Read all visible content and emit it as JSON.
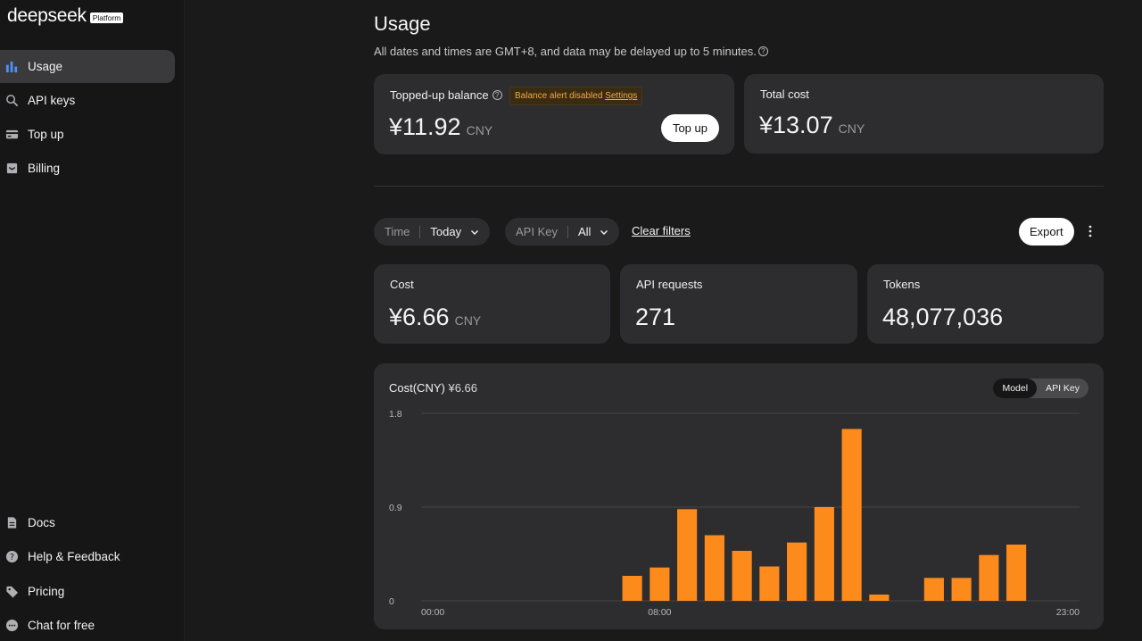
{
  "brand": {
    "name": "deepseek",
    "badge": "Platform"
  },
  "sidebar": {
    "items": [
      {
        "label": "Usage",
        "icon": "bar-chart-icon",
        "active": true
      },
      {
        "label": "API keys",
        "icon": "search-icon"
      },
      {
        "label": "Top up",
        "icon": "wallet-icon"
      },
      {
        "label": "Billing",
        "icon": "invoice-icon"
      }
    ],
    "bottom": [
      {
        "label": "Docs",
        "icon": "document-icon"
      },
      {
        "label": "Help & Feedback",
        "icon": "help-icon"
      },
      {
        "label": "Pricing",
        "icon": "tag-icon"
      },
      {
        "label": "Chat for free",
        "icon": "chat-icon"
      }
    ]
  },
  "page": {
    "title": "Usage",
    "subtitle": "All dates and times are GMT+8, and data may be delayed up to 5 minutes."
  },
  "balance": {
    "label": "Topped-up balance",
    "alert_text": "Balance alert disabled",
    "alert_link": "Settings",
    "value": "¥11.92",
    "unit": "CNY",
    "button": "Top up"
  },
  "total_cost": {
    "label": "Total cost",
    "value": "¥13.07",
    "unit": "CNY"
  },
  "filters": {
    "time_key": "Time",
    "time_value": "Today",
    "apikey_key": "API Key",
    "apikey_value": "All",
    "clear": "Clear filters",
    "export": "Export"
  },
  "stats": {
    "cost": {
      "label": "Cost",
      "value": "¥6.66",
      "unit": "CNY"
    },
    "requests": {
      "label": "API requests",
      "value": "271"
    },
    "tokens": {
      "label": "Tokens",
      "value": "48,077,036"
    }
  },
  "chart": {
    "title": "Cost(CNY)",
    "total": "¥6.66",
    "toggle_model": "Model",
    "toggle_apikey": "API Key",
    "bar_color": "#fd8b1b"
  },
  "chart_data": {
    "type": "bar",
    "title": "Cost(CNY) ¥6.66",
    "categories": [
      "00:00",
      "01:00",
      "02:00",
      "03:00",
      "04:00",
      "05:00",
      "06:00",
      "07:00",
      "08:00",
      "09:00",
      "10:00",
      "11:00",
      "12:00",
      "13:00",
      "14:00",
      "15:00",
      "16:00",
      "17:00",
      "18:00",
      "19:00",
      "20:00",
      "21:00",
      "22:00",
      "23:00"
    ],
    "values": [
      0,
      0,
      0,
      0,
      0,
      0,
      0,
      0.24,
      0.32,
      0.88,
      0.63,
      0.48,
      0.33,
      0.56,
      0.9,
      1.65,
      0.06,
      0,
      0.22,
      0.22,
      0.44,
      0.54,
      0,
      0
    ],
    "xticks": [
      "00:00",
      "08:00",
      "",
      "23:00"
    ],
    "yticks": [
      "1.8",
      "0.9",
      "0"
    ],
    "ylim": [
      0,
      1.8
    ],
    "grid": true
  }
}
